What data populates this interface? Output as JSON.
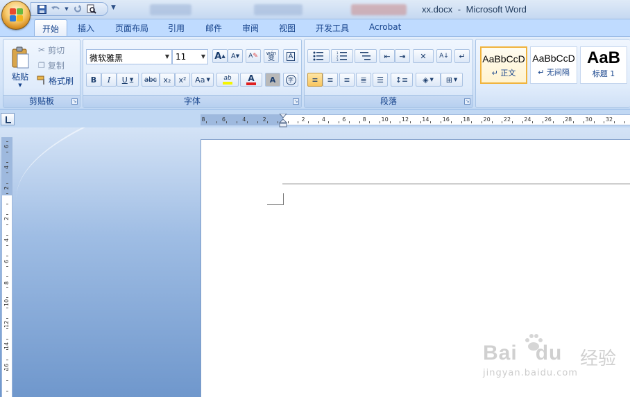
{
  "window": {
    "title_file": "xx.docx",
    "title_separator": "-",
    "title_app": "Microsoft Word"
  },
  "tabs": [
    {
      "label": "开始",
      "active": true
    },
    {
      "label": "插入"
    },
    {
      "label": "页面布局"
    },
    {
      "label": "引用"
    },
    {
      "label": "邮件"
    },
    {
      "label": "审阅"
    },
    {
      "label": "视图"
    },
    {
      "label": "开发工具"
    },
    {
      "label": "Acrobat"
    }
  ],
  "clipboard": {
    "paste_label": "粘贴",
    "cut_label": "剪切",
    "copy_label": "复制",
    "format_painter_label": "格式刷",
    "group_label": "剪贴板"
  },
  "font": {
    "font_name": "微软雅黑",
    "font_size": "11",
    "group_label": "字体",
    "phonetic_glyph": "wén",
    "phonetic_char": "变",
    "highlight_glyph": "ab",
    "font_color_glyph": "A",
    "change_case": "Aa",
    "bold": "B",
    "italic": "I",
    "underline": "U",
    "strike": "abc",
    "subscript": "x₂",
    "superscript": "x²",
    "shading": "A",
    "enclose": "字",
    "grow": "A",
    "shrink": "A",
    "clear": "A",
    "border_char": "A",
    "highlight_color": "#f5f500",
    "font_color": "#e02020"
  },
  "paragraph": {
    "group_label": "段落"
  },
  "styles": [
    {
      "sample": "AaBbCcD",
      "name": "↵ 正文",
      "selected": true
    },
    {
      "sample": "AaBbCcD",
      "name": "↵ 无间隔"
    },
    {
      "sample": "AaB",
      "name": "标题 1"
    }
  ],
  "ruler": {
    "h_labels": [
      "8",
      "6",
      "4",
      "2",
      "2",
      "4",
      "6",
      "8",
      "10",
      "12",
      "14",
      "16",
      "18",
      "20",
      "22",
      "24",
      "26",
      "28",
      "30",
      "32"
    ],
    "v_labels": [
      "6",
      "4",
      "2",
      "2",
      "4",
      "6",
      "8",
      "10",
      "12",
      "14",
      "16"
    ]
  },
  "watermark": {
    "brand": "Bai",
    "brand2": "du",
    "cn": "经验",
    "url": "jingyan.baidu.com"
  }
}
